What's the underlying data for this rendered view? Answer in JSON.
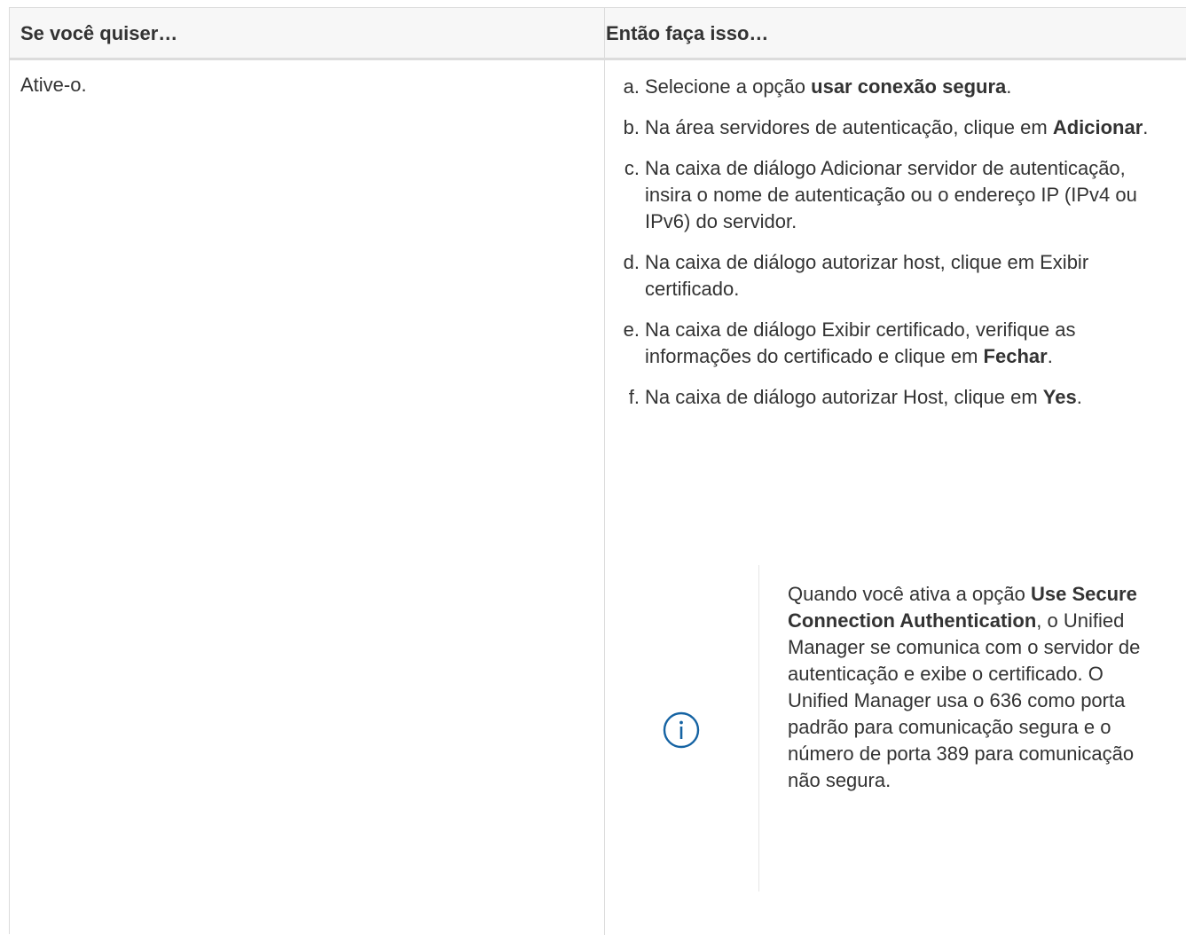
{
  "table": {
    "headers": [
      "Se você quiser…",
      "Então faça isso…"
    ],
    "left_cell": "Ative-o.",
    "steps": [
      {
        "marker": "a.",
        "parts": [
          {
            "t": "Selecione a opção "
          },
          {
            "t": "usar conexão segura",
            "b": true
          },
          {
            "t": "."
          }
        ]
      },
      {
        "marker": "b.",
        "parts": [
          {
            "t": "Na área servidores de autenticação, clique em "
          },
          {
            "t": "Adicionar",
            "b": true
          },
          {
            "t": "."
          }
        ]
      },
      {
        "marker": "c.",
        "parts": [
          {
            "t": "Na caixa de diálogo Adicionar servidor de autenticação, insira o nome de autenticação ou o endereço IP (IPv4 ou IPv6) do servidor."
          }
        ]
      },
      {
        "marker": "d.",
        "parts": [
          {
            "t": "Na caixa de diálogo autorizar host, clique em Exibir certificado."
          }
        ]
      },
      {
        "marker": "e.",
        "parts": [
          {
            "t": "Na caixa de diálogo Exibir certificado, verifique as informações do certificado e clique em "
          },
          {
            "t": "Fechar",
            "b": true
          },
          {
            "t": "."
          }
        ]
      },
      {
        "marker": "f.",
        "parts": [
          {
            "t": "Na caixa de diálogo autorizar Host, clique em "
          },
          {
            "t": "Yes",
            "b": true
          },
          {
            "t": "."
          }
        ]
      }
    ],
    "note": {
      "icon": "info-icon",
      "icon_color": "#1563a3",
      "parts": [
        {
          "t": "Quando você ativa a opção "
        },
        {
          "t": "Use Secure Connection Authentication",
          "b": true
        },
        {
          "t": ", o Unified Manager se comunica com o servidor de autenticação e exibe o certificado. O Unified Manager usa o 636 como porta padrão para comunicação segura e o número de porta 389 para comunicação não segura."
        }
      ]
    }
  }
}
